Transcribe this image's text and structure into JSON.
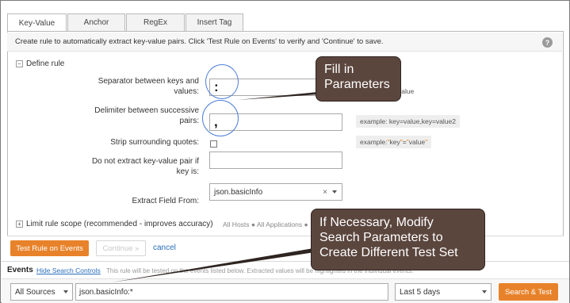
{
  "tabs": [
    {
      "label": "Key-Value",
      "active": true
    },
    {
      "label": "Anchor",
      "active": false
    },
    {
      "label": "RegEx",
      "active": false
    },
    {
      "label": "Insert Tag",
      "active": false
    }
  ],
  "info_text": "Create rule to automatically extract key-value pairs. Click 'Test Rule on Events' to verify and 'Continue' to save.",
  "help_icon": "?",
  "define_rule": {
    "toggle": "−",
    "label": "Define rule"
  },
  "fields": {
    "separator": {
      "label": "Separator between keys and values:",
      "value": ":",
      "example_suffix": "=value"
    },
    "delimiter": {
      "label": "Delimiter between successive pairs:",
      "value": ",",
      "example": "example: key=value,key=value2"
    },
    "strip_quotes": {
      "label": "Strip surrounding quotes:",
      "checked": false,
      "example_pre": "example: ",
      "example_q1": "\"",
      "example_key": "key",
      "example_q2": "\"",
      "example_eq": "=",
      "example_q3": "\"",
      "example_val": "value",
      "example_q4": "\""
    },
    "exclude": {
      "label": "Do not extract key-value pair if key is:",
      "value": ""
    },
    "extract_field": {
      "label": "Extract Field From:",
      "value": "json.basicInfo",
      "clear": "×"
    }
  },
  "scope": {
    "toggle": "+",
    "label": "Limit rule scope (recommended - improves accuracy)",
    "tags": "All Hosts ● All Applications ●"
  },
  "buttons": {
    "test": "Test Rule on Events",
    "continue": "Continue »",
    "cancel": "cancel"
  },
  "events": {
    "label": "Events",
    "hide_link": "Hide Search Controls",
    "desc": "This rule will be tested on the events listed below. Extracted values will be highlighted in the individual events."
  },
  "bottom": {
    "source": "All Sources",
    "query": "json.basicInfo:*",
    "time": "Last 5 days",
    "search_button": "Search & Test"
  },
  "callouts": {
    "fill": "Fill in Parameters",
    "modify": "If Necessary, Modify Search Parameters to Create Different Test Set"
  },
  "colors": {
    "accent": "#e8822a",
    "callout_bg": "#5b463e",
    "ring": "#4f7fd8",
    "link": "#2a6ebb"
  }
}
